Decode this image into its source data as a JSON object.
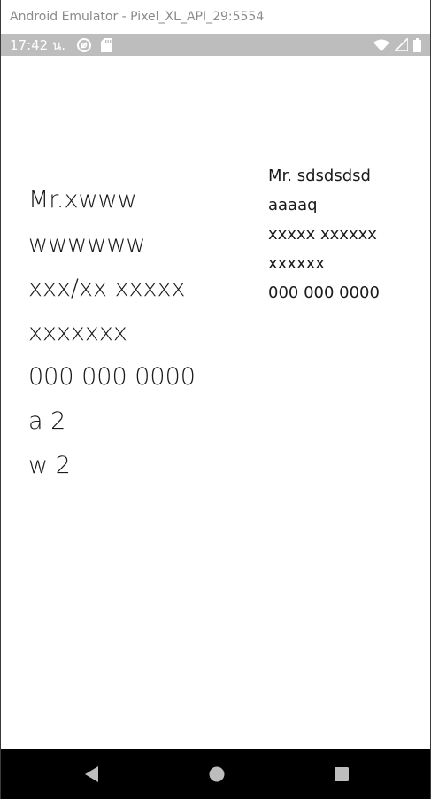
{
  "window": {
    "title": "Android Emulator - Pixel_XL_API_29:5554"
  },
  "status_bar": {
    "time": "17:42 น.",
    "left_icons": [
      "circle-slash-icon",
      "sd-card-icon"
    ],
    "right_icons": [
      "wifi-icon",
      "cell-signal-icon",
      "battery-icon"
    ]
  },
  "content": {
    "left_lines": [
      "Mr.xwww",
      "wwwwww",
      "xxx/xx xxxxx",
      "xxxxxxx",
      "000 000 0000",
      "a 2",
      "w 2"
    ],
    "right_lines": [
      "Mr. sdsdsdsd",
      "aaaaq",
      "xxxxx xxxxxx",
      "xxxxxx",
      "000 000 0000"
    ]
  },
  "nav_bar": {
    "buttons": [
      "back-icon",
      "home-icon",
      "recents-icon"
    ]
  },
  "colors": {
    "status_bar_bg": "#bdbdbd",
    "nav_bar_bg": "#000000",
    "text": "#1a1a1a"
  }
}
